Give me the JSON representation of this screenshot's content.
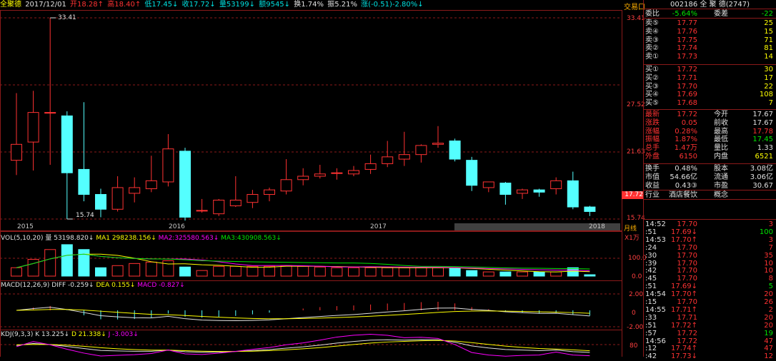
{
  "header": {
    "name": "全聚德",
    "date": "2017/12/01",
    "open": "开18.28↑",
    "high": "高18.40↑",
    "low": "低17.45↓",
    "close": "收17.72↓",
    "volume": "量53199↓",
    "amount": "额9545↓",
    "turnover": "换1.74%",
    "amplitude": "振5.21%",
    "change": "涨(-0.51)-2.80%↓"
  },
  "top_label": "交易口",
  "right_header": "002186 全 聚 德(2747)",
  "price_axis": [
    "33.41",
    "27.52",
    "21.63",
    "15.74"
  ],
  "current_price_tag": "17.72",
  "annotations": {
    "high": "33.41",
    "low": "15.74"
  },
  "x_axis": {
    "labels": [
      "2015",
      "2016",
      "2017",
      "2018"
    ],
    "period": "月线"
  },
  "vol": {
    "title": "VOL(5,10,20)",
    "v": "量 53198.820↓",
    "ma1": "MA1 298238.156↓",
    "ma2": "MA2:325580.563↓",
    "ma3": "MA3:430908.563↓",
    "unit": "X1万",
    "ticks": [
      "100.0",
      "0.0"
    ]
  },
  "macd": {
    "title": "MACD(12,26,9)",
    "diff": "DIFF -0.259↓",
    "dea": "DEA 0.155↓",
    "macd": "MACD -0.827↓",
    "ticks": [
      "2.00",
      "0",
      "-2.00"
    ]
  },
  "kdj": {
    "title": "KDJ(9,3,3)",
    "k": "K 13.225↓",
    "d": "D 21.338↓",
    "j": "J -3.003↓",
    "ticks": [
      "80"
    ]
  },
  "colors": {
    "up": "#ff3232",
    "down": "#54ffff",
    "grid": "#8b1a1a",
    "yellow": "#ffff00",
    "magenta": "#ff00ff",
    "green": "#00e600"
  },
  "chart_data": {
    "type": "candlestick",
    "title": "",
    "xlabel": "",
    "ylabel": "",
    "ylim": [
      15.74,
      33.41
    ],
    "candles": [
      {
        "o": 20.9,
        "c": 22.3,
        "h": 26.8,
        "l": 19.6
      },
      {
        "o": 22.5,
        "c": 25.1,
        "h": 27.0,
        "l": 20.0
      },
      {
        "o": 25.1,
        "c": 25.1,
        "h": 33.41,
        "l": 20.5
      },
      {
        "o": 24.8,
        "c": 19.8,
        "h": 25.2,
        "l": 15.74
      },
      {
        "o": 20.1,
        "c": 17.9,
        "h": 26.0,
        "l": 17.3
      },
      {
        "o": 17.9,
        "c": 16.6,
        "h": 18.4,
        "l": 15.9
      },
      {
        "o": 16.6,
        "c": 18.5,
        "h": 19.5,
        "l": 16.4
      },
      {
        "o": 18.0,
        "c": 18.5,
        "h": 19.4,
        "l": 17.2
      },
      {
        "o": 18.4,
        "c": 19.1,
        "h": 21.3,
        "l": 18.1
      },
      {
        "o": 19.0,
        "c": 21.9,
        "h": 23.2,
        "l": 18.6
      },
      {
        "o": 21.7,
        "c": 15.9,
        "h": 22.0,
        "l": 15.6
      },
      {
        "o": 16.5,
        "c": 16.5,
        "h": 17.5,
        "l": 16.3
      },
      {
        "o": 16.2,
        "c": 17.4,
        "h": 17.5,
        "l": 16.0
      },
      {
        "o": 16.9,
        "c": 17.4,
        "h": 19.5,
        "l": 16.8
      },
      {
        "o": 17.2,
        "c": 17.9,
        "h": 18.3,
        "l": 16.7
      },
      {
        "o": 17.9,
        "c": 18.3,
        "h": 18.5,
        "l": 17.3
      },
      {
        "o": 18.2,
        "c": 19.2,
        "h": 21.0,
        "l": 17.9
      },
      {
        "o": 19.2,
        "c": 19.5,
        "h": 20.2,
        "l": 18.7
      },
      {
        "o": 19.5,
        "c": 19.7,
        "h": 20.5,
        "l": 19.3
      },
      {
        "o": 19.8,
        "c": 19.8,
        "h": 20.2,
        "l": 19.2
      },
      {
        "o": 19.7,
        "c": 20.0,
        "h": 20.4,
        "l": 19.5
      },
      {
        "o": 20.1,
        "c": 20.6,
        "h": 21.4,
        "l": 19.7
      },
      {
        "o": 20.6,
        "c": 21.2,
        "h": 22.6,
        "l": 20.3
      },
      {
        "o": 21.0,
        "c": 21.4,
        "h": 23.4,
        "l": 20.4
      },
      {
        "o": 21.4,
        "c": 22.2,
        "h": 22.3,
        "l": 20.7
      },
      {
        "o": 22.3,
        "c": 22.4,
        "h": 23.9,
        "l": 22.0
      },
      {
        "o": 22.6,
        "c": 21.0,
        "h": 22.8,
        "l": 20.8
      },
      {
        "o": 20.9,
        "c": 18.7,
        "h": 21.2,
        "l": 18.2
      },
      {
        "o": 18.5,
        "c": 19.0,
        "h": 19.0,
        "l": 18.1
      },
      {
        "o": 18.9,
        "c": 17.9,
        "h": 19.0,
        "l": 17.0
      },
      {
        "o": 18.0,
        "c": 18.3,
        "h": 18.4,
        "l": 17.5
      },
      {
        "o": 18.3,
        "c": 18.1,
        "h": 18.4,
        "l": 17.7
      },
      {
        "o": 18.4,
        "c": 19.1,
        "h": 19.4,
        "l": 17.9
      },
      {
        "o": 19.1,
        "c": 16.8,
        "h": 19.9,
        "l": 16.6
      },
      {
        "o": 16.8,
        "c": 16.4,
        "h": 16.9,
        "l": 16.0
      }
    ],
    "volume": [
      12,
      24,
      38,
      45,
      38,
      12,
      15,
      18,
      20,
      22,
      13,
      8,
      14,
      14,
      14,
      14,
      15,
      14,
      13,
      12,
      12,
      12,
      12,
      12,
      12,
      12,
      11,
      8,
      6,
      6,
      6,
      6,
      6,
      12,
      2
    ],
    "volume_ylim": [
      0,
      100
    ]
  },
  "quote": {
    "wb_label": "委比",
    "wb_pct": "-5.64%",
    "wc_label": "委差",
    "wc_val": "-22",
    "sells": [
      {
        "label": "卖⑤",
        "price": "17.77",
        "vol": "25"
      },
      {
        "label": "卖④",
        "price": "17.76",
        "vol": "15"
      },
      {
        "label": "卖③",
        "price": "17.75",
        "vol": "71"
      },
      {
        "label": "卖②",
        "price": "17.74",
        "vol": "81"
      },
      {
        "label": "卖①",
        "price": "17.73",
        "vol": "14"
      }
    ],
    "buys": [
      {
        "label": "买①",
        "price": "17.72",
        "vol": "30"
      },
      {
        "label": "买②",
        "price": "17.71",
        "vol": "17"
      },
      {
        "label": "买③",
        "price": "17.70",
        "vol": "22"
      },
      {
        "label": "买④",
        "price": "17.69",
        "vol": "108"
      },
      {
        "label": "买⑤",
        "price": "17.68",
        "vol": "7"
      }
    ],
    "stats": [
      {
        "l1": "最新",
        "v1": "17.72",
        "l2": "今开",
        "v2": "17.67"
      },
      {
        "l1": "涨跌",
        "v1": "0.05",
        "l2": "前收",
        "v2": "17.67"
      },
      {
        "l1": "涨幅",
        "v1": "0.28%",
        "l2": "最高",
        "v2": "17.78"
      },
      {
        "l1": "振幅",
        "v1": "1.87%",
        "l2": "最低",
        "v2": "17.45"
      },
      {
        "l1": "总手",
        "v1": "1.47万",
        "l2": "量比",
        "v2": "1.33"
      },
      {
        "l1": "外盘",
        "v1": "6150",
        "l2": "内盘",
        "v2": "6521"
      }
    ],
    "info": [
      {
        "l1": "换手",
        "v1": "0.48%",
        "l2": "股本",
        "v2": "3.08亿"
      },
      {
        "l1": "市值",
        "v1": "54.66亿",
        "l2": "流通",
        "v2": "3.06亿"
      },
      {
        "l1": "收益",
        "v1": "0.43③",
        "l2": "市盈",
        "v2": "30.67"
      }
    ],
    "industry_label": "行业",
    "industry": "酒店餐饮",
    "concept_label": "概念"
  },
  "ticks": [
    {
      "t": "14:52",
      "p": "17.70",
      "v": "3",
      "d": "sell"
    },
    {
      "t": ":51",
      "p": "17.69↓",
      "v": "100",
      "d": "buy"
    },
    {
      "t": "14:53",
      "p": "17.70↑",
      "v": "3",
      "d": "sell"
    },
    {
      "t": ":24",
      "p": "17.70",
      "v": "7",
      "d": "sell"
    },
    {
      "t": ":30",
      "p": "17.70",
      "v": "35",
      "d": "sell"
    },
    {
      "t": ":39",
      "p": "17.70",
      "v": "10",
      "d": "sell"
    },
    {
      "t": ":42",
      "p": "17.70",
      "v": "10",
      "d": "sell"
    },
    {
      "t": ":45",
      "p": "17.70",
      "v": "8",
      "d": "sell"
    },
    {
      "t": ":51",
      "p": "17.69↓",
      "v": "5",
      "d": "buy"
    },
    {
      "t": "14:54",
      "p": "17.70↑",
      "v": "20",
      "d": "sell"
    },
    {
      "t": ":15",
      "p": "17.70",
      "v": "26",
      "d": "sell"
    },
    {
      "t": "14:55",
      "p": "17.71↑",
      "v": "2",
      "d": "sell"
    },
    {
      "t": ":33",
      "p": "17.71",
      "v": "20",
      "d": "sell"
    },
    {
      "t": ":51",
      "p": "17.72↑",
      "v": "20",
      "d": "sell"
    },
    {
      "t": ":57",
      "p": "17.72",
      "v": "19",
      "d": "buy"
    },
    {
      "t": "14:56",
      "p": "17.72",
      "v": "47",
      "d": "sell"
    },
    {
      "t": ":12",
      "p": "17.74↑",
      "v": "47",
      "d": "sell"
    },
    {
      "t": ":42",
      "p": "17.73↓",
      "v": "12",
      "d": "sell"
    }
  ]
}
